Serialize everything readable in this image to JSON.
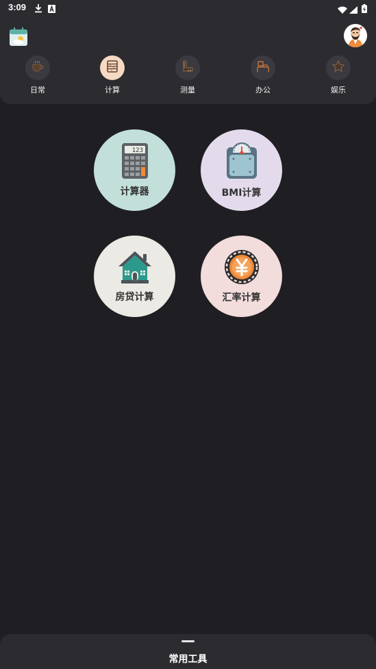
{
  "status_bar": {
    "time": "3:09"
  },
  "tabs": [
    {
      "label": "日常",
      "icon": "coffee-cup-icon",
      "active": false
    },
    {
      "label": "计算",
      "icon": "abacus-icon",
      "active": true
    },
    {
      "label": "测量",
      "icon": "ruler-icon",
      "active": false
    },
    {
      "label": "办公",
      "icon": "office-desk-icon",
      "active": false
    },
    {
      "label": "娱乐",
      "icon": "star-icon",
      "active": false
    }
  ],
  "tools": [
    {
      "label": "计算器",
      "icon": "calculator-icon",
      "color": "#c3dfda",
      "display": "123"
    },
    {
      "label": "BMI计算",
      "icon": "scale-icon",
      "color": "#e3dbec"
    },
    {
      "label": "房贷计算",
      "icon": "house-icon",
      "color": "#eceae4"
    },
    {
      "label": "汇率计算",
      "icon": "yuan-coin-icon",
      "color": "#f2dcdc"
    }
  ],
  "bottom_sheet": {
    "title": "常用工具"
  },
  "colors": {
    "background": "#1f1e22",
    "panel": "#2c2b30",
    "active_tab": "#f6d9c3",
    "accent_orange": "#f0883a"
  }
}
